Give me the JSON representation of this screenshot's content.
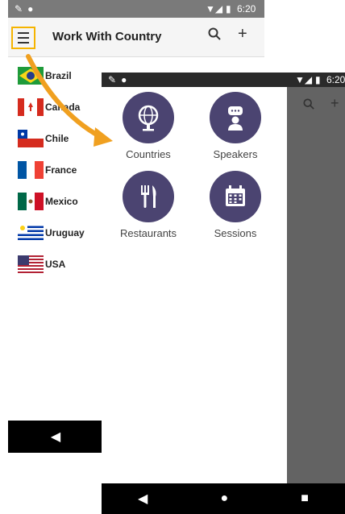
{
  "colors": {
    "accent": "#4b4471",
    "highlight": "#f5b400",
    "arrow": "#f0a020"
  },
  "left_phone": {
    "status": {
      "time": "6:20"
    },
    "app_title": "Work With Country",
    "countries": [
      {
        "name": "Brazil",
        "flag": "brazil-flag-icon"
      },
      {
        "name": "Canada",
        "flag": "canada-flag-icon"
      },
      {
        "name": "Chile",
        "flag": "chile-flag-icon"
      },
      {
        "name": "France",
        "flag": "france-flag-icon"
      },
      {
        "name": "Mexico",
        "flag": "mexico-flag-icon"
      },
      {
        "name": "Uruguay",
        "flag": "uruguay-flag-icon"
      },
      {
        "name": "USA",
        "flag": "usa-flag-icon"
      }
    ]
  },
  "right_phone": {
    "status": {
      "time": "6:20"
    },
    "menu": [
      {
        "label": "Countries",
        "icon": "globe-icon"
      },
      {
        "label": "Speakers",
        "icon": "speaker-icon"
      },
      {
        "label": "Restaurants",
        "icon": "fork-knife-icon"
      },
      {
        "label": "Sessions",
        "icon": "calendar-icon"
      }
    ]
  }
}
